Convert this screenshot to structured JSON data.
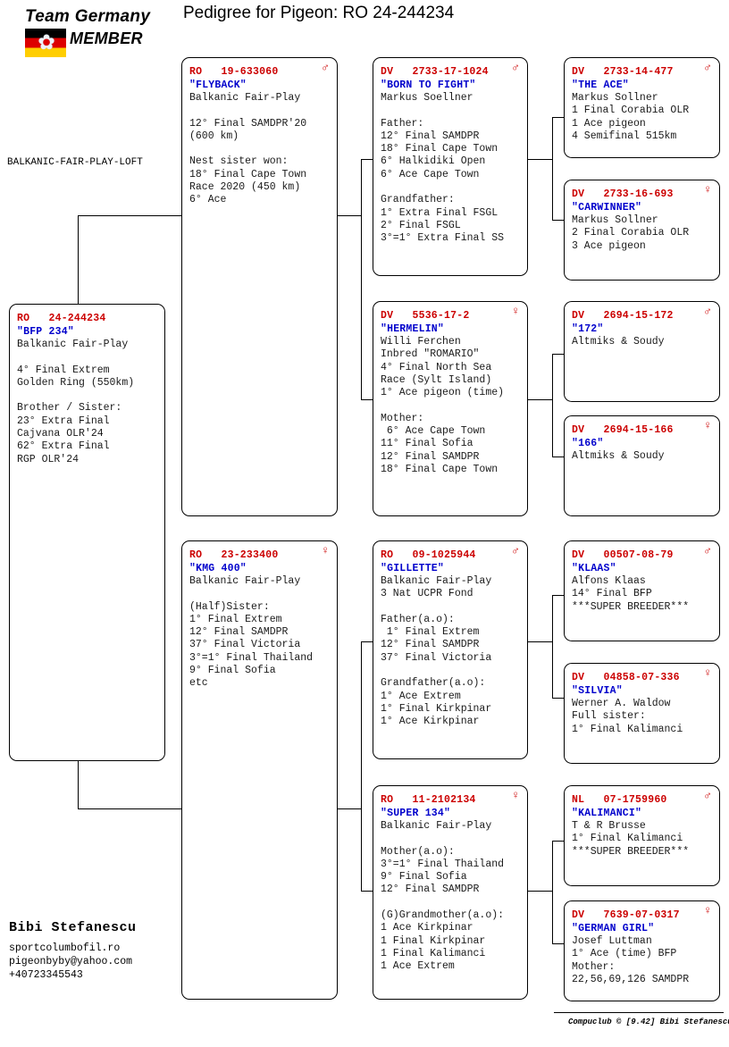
{
  "header": {
    "title": "Pedigree for Pigeon: RO  24-244234",
    "logo": {
      "team_text": "Team Germany",
      "member_text": "MEMBER",
      "dove_icon": "dove-icon",
      "flag_icon": "german-flag-icon"
    },
    "loft_label": "BALKANIC-FAIR-PLAY-LOFT"
  },
  "owner": {
    "name": "Bibi Stefanescu",
    "website": "sportcolumbofil.ro",
    "email": "pigeonbyby@yahoo.com",
    "phone": "+40723345543"
  },
  "footer": {
    "credit": "Compuclub © [9.42]  Bibi Stefanescu"
  },
  "colors": {
    "ring": "#cc0000",
    "name": "#0000cc",
    "text": "#1a1a1a",
    "border": "#000000"
  },
  "subject": {
    "ring": "RO   24-244234",
    "name": "\"BFP 234\"",
    "sex": "",
    "lines": "Balkanic Fair-Play\n\n4° Final Extrem\nGolden Ring (550km)\n\nBrother / Sister:\n23° Extra Final\nCajvana OLR'24\n62° Extra Final\nRGP OLR'24"
  },
  "gen2": [
    {
      "id": "sire",
      "ring": "RO   19-633060",
      "name": "\"FLYBACK\"",
      "sex": "♂",
      "lines": "Balkanic Fair-Play\n\n12° Final SAMDPR'20\n(600 km)\n\nNest sister won:\n18° Final Cape Town\nRace 2020 (450 km)\n6° Ace"
    },
    {
      "id": "dam",
      "ring": "RO   23-233400",
      "name": "\"KMG 400\"",
      "sex": "♀",
      "lines": "Balkanic Fair-Play\n\n(Half)Sister:\n1° Final Extrem\n12° Final SAMDPR\n37° Final Victoria\n3°=1° Final Thailand\n9° Final Sofia\netc"
    }
  ],
  "gen3": [
    {
      "id": "sire-sire",
      "ring": "DV   2733-17-1024",
      "name": "\"BORN TO FIGHT\"",
      "sex": "♂",
      "lines": "Markus Soellner\n\nFather:\n12° Final SAMDPR\n18° Final Cape Town\n6° Halkidiki Open\n6° Ace Cape Town\n\nGrandfather:\n1° Extra Final FSGL\n2° Final FSGL\n3°=1° Extra Final SS"
    },
    {
      "id": "sire-dam",
      "ring": "DV   5536-17-2",
      "name": "\"HERMELIN\"",
      "sex": "♀",
      "lines": "Willi Ferchen\nInbred \"ROMARIO\"\n4° Final North Sea\nRace (Sylt Island)\n1° Ace pigeon (time)\n\nMother:\n 6° Ace Cape Town\n11° Final Sofia\n12° Final SAMDPR\n18° Final Cape Town"
    },
    {
      "id": "dam-sire",
      "ring": "RO   09-1025944",
      "name": "\"GILLETTE\"",
      "sex": "♂",
      "lines": "Balkanic Fair-Play\n3 Nat UCPR Fond\n\nFather(a.o):\n 1° Final Extrem\n12° Final SAMDPR\n37° Final Victoria\n\nGrandfather(a.o):\n1° Ace Extrem\n1° Final Kirkpinar\n1° Ace Kirkpinar"
    },
    {
      "id": "dam-dam",
      "ring": "RO   11-2102134",
      "name": "\"SUPER 134\"",
      "sex": "♀",
      "lines": "Balkanic Fair-Play\n\nMother(a.o):\n3°=1° Final Thailand\n9° Final Sofia\n12° Final SAMDPR\n\n(G)Grandmother(a.o):\n1 Ace Kirkpinar\n1 Final Kirkpinar\n1 Final Kalimanci\n1 Ace Extrem"
    }
  ],
  "gen4": [
    {
      "id": "ss-sire",
      "ring": "DV   2733-14-477",
      "name": "\"THE ACE\"",
      "sex": "♂",
      "lines": "Markus Sollner\n1 Final Corabia OLR\n1 Ace pigeon\n4 Semifinal 515km"
    },
    {
      "id": "ss-dam",
      "ring": "DV   2733-16-693",
      "name": "\"CARWINNER\"",
      "sex": "♀",
      "lines": "Markus Sollner\n2 Final Corabia OLR\n3 Ace pigeon"
    },
    {
      "id": "sd-sire",
      "ring": "DV   2694-15-172",
      "name": "\"172\"",
      "sex": "♂",
      "lines": "Altmiks & Soudy"
    },
    {
      "id": "sd-dam",
      "ring": "DV   2694-15-166",
      "name": "\"166\"",
      "sex": "♀",
      "lines": "Altmiks & Soudy"
    },
    {
      "id": "ds-sire",
      "ring": "DV   00507-08-79",
      "name": "\"KLAAS\"",
      "sex": "♂",
      "lines": "Alfons Klaas\n14° Final BFP\n***SUPER BREEDER***"
    },
    {
      "id": "ds-dam",
      "ring": "DV   04858-07-336",
      "name": "\"SILVIA\"",
      "sex": "♀",
      "lines": "Werner A. Waldow\nFull sister:\n1° Final Kalimanci"
    },
    {
      "id": "dd-sire",
      "ring": "NL   07-1759960",
      "name": "\"KALIMANCI\"",
      "sex": "♂",
      "lines": "T & R Brusse\n1° Final Kalimanci\n***SUPER BREEDER***"
    },
    {
      "id": "dd-dam",
      "ring": "DV   7639-07-0317",
      "name": "\"GERMAN GIRL\"",
      "sex": "♀",
      "lines": "Josef Luttman\n1° Ace (time) BFP\nMother:\n22,56,69,126 SAMDPR"
    }
  ]
}
